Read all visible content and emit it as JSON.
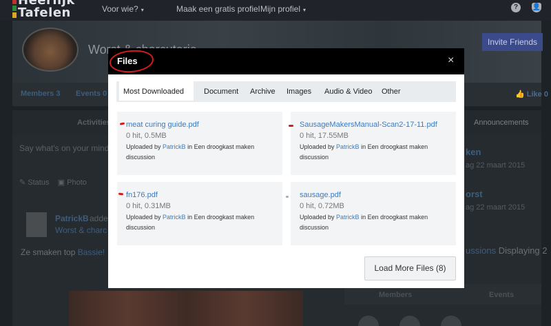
{
  "site": {
    "logo_line1": "Heerlijk",
    "logo_line2": "Tafelen",
    "nav": [
      "Voor wie?",
      "Maak een gratis profiel",
      "Mijn profiel"
    ],
    "help_icon": "question-icon",
    "user_icon": "user-icon"
  },
  "group": {
    "title": "Worst & charcuterie",
    "invite_label": "Invite Friends",
    "members_label": "Members 3",
    "events_label": "Events 0",
    "like_label": "Like 0"
  },
  "subtabs": {
    "activities": "Activities",
    "announcements": "Announcements"
  },
  "feed": {
    "composer_placeholder": "Say what's on your mind",
    "status_label": "Status",
    "photo_label": "Photo",
    "author": "PatrickB",
    "added": "added",
    "group_link": "Worst & charc",
    "post_text": "Ze smaken top ",
    "post_link": "Bassie!"
  },
  "sidebar": {
    "item1": "ken",
    "date1": "ag 22 maart 2015",
    "item2": "orst",
    "date2": "ag 22 maart 2015",
    "discussions": "ussions",
    "displaying": " Displaying 2",
    "tab_members": "Members",
    "tab_events": "Events"
  },
  "modal": {
    "title": "Files",
    "close_symbol": "×",
    "tabs": [
      "Most Downloaded",
      "Document",
      "Archive",
      "Images",
      "Audio & Video",
      "Other"
    ],
    "active_tab": "Most Downloaded",
    "files": [
      {
        "name": "meat curing guide.pdf",
        "meta": "0 hit, 0.5MB",
        "uploaded_prefix": "Uploaded by ",
        "uploader": "PatrickB",
        "in_text": " in Een droogkast maken discussion"
      },
      {
        "name": "SausageMakersManual-Scan2-17-11.pdf",
        "meta": "0 hit, 17.55MB",
        "uploaded_prefix": "Uploaded by ",
        "uploader": "PatrickB",
        "in_text": " in Een droogkast maken discussion"
      },
      {
        "name": "fn176.pdf",
        "meta": "0 hit, 0.31MB",
        "uploaded_prefix": "Uploaded by ",
        "uploader": "PatrickB",
        "in_text": " in Een droogkast maken discussion"
      },
      {
        "name": "sausage.pdf",
        "meta": "0 hit, 0.72MB",
        "uploaded_prefix": "Uploaded by ",
        "uploader": "PatrickB",
        "in_text": " in Een droogkast maken discussion"
      }
    ],
    "load_more_label": "Load More Files (8)"
  },
  "colors": {
    "overlay_bg": "#1d2227",
    "modal_header": "#000000",
    "link_blue": "#3a7bc0",
    "annotation_red": "#d41c1c",
    "invite_button": "#3a4a8a"
  }
}
